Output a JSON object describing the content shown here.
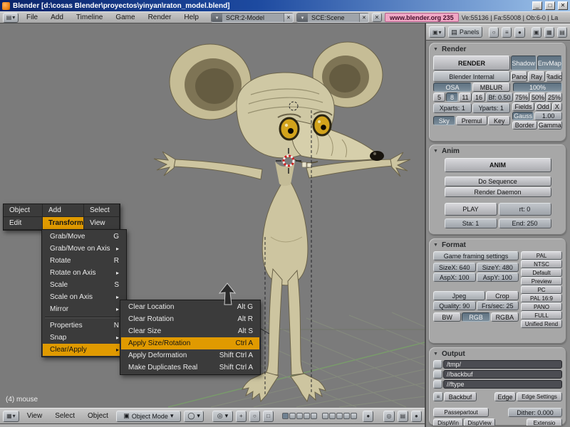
{
  "icons": {
    "minimize": "_",
    "maximize": "□",
    "close": "✕",
    "dropdown": "▾",
    "browse": "▤",
    "grid": "▦",
    "box": "▣",
    "submenu": "▸",
    "collapse": "▼",
    "lines": "≡",
    "ring": "○",
    "circle": "●",
    "target": "◎",
    "sphere": "◯",
    "plus": "+",
    "square": "□"
  },
  "titlebar": {
    "title": "Blender [d:\\cosas Blender\\proyectos\\yinyan\\raton_model.blend]"
  },
  "topbar": {
    "menus": [
      "File",
      "Add",
      "Timeline",
      "Game",
      "Render",
      "Help"
    ],
    "screen": "SCR:2-Model",
    "scene": "SCE:Scene",
    "site": "www.blender.org 235",
    "stats": "Ve:55136 | Fa:55008 | Ob:6-0 | La"
  },
  "toolbox": {
    "cells": [
      "Object",
      "Add",
      "Select",
      "Edit",
      "Transform",
      "View"
    ]
  },
  "transform_menu": {
    "items": [
      {
        "label": "Grab/Move",
        "shortcut": "G"
      },
      {
        "label": "Grab/Move on Axis",
        "submenu": true
      },
      {
        "label": "Rotate",
        "shortcut": "R"
      },
      {
        "label": "Rotate on Axis",
        "submenu": true
      },
      {
        "label": "Scale",
        "shortcut": "S"
      },
      {
        "label": "Scale on Axis",
        "submenu": true
      },
      {
        "label": "Mirror",
        "submenu": true
      },
      {
        "label": "Properties",
        "shortcut": "N"
      },
      {
        "label": "Snap",
        "submenu": true
      },
      {
        "label": "Clear/Apply",
        "submenu": true,
        "highlighted": true
      }
    ]
  },
  "clear_apply_menu": {
    "items": [
      {
        "label": "Clear Location",
        "shortcut": "Alt G"
      },
      {
        "label": "Clear Rotation",
        "shortcut": "Alt R"
      },
      {
        "label": "Clear Size",
        "shortcut": "Alt S"
      },
      {
        "label": "Apply Size/Rotation",
        "shortcut": "Ctrl A",
        "highlighted": true
      },
      {
        "label": "Apply Deformation",
        "shortcut": "Shift Ctrl A"
      },
      {
        "label": "Make Duplicates Real",
        "shortcut": "Shift Ctrl A"
      }
    ]
  },
  "viewport": {
    "object_info": "(4) mouse"
  },
  "view3d_header": {
    "menus": [
      "View",
      "Select",
      "Object"
    ],
    "mode": "Object Mode"
  },
  "buttons_header": {
    "panels": "Panels"
  },
  "render_panel": {
    "title": "Render",
    "render": "RENDER",
    "shadow": "Shadow",
    "envmap": "EnvMap",
    "engine": "Blender Internal",
    "pano": "Pano",
    "ray": "Ray",
    "radio": "Radio",
    "osa": "OSA",
    "mblur": "MBLUR",
    "pct100": "100%",
    "s5": "5",
    "s8": "8",
    "s11": "11",
    "s16": "16",
    "bf": "Bf: 0.50",
    "pct75": "75%",
    "pct50": "50%",
    "pct25": "25%",
    "xparts": "Xparts: 1",
    "yparts": "Yparts: 1",
    "fields": "Fields",
    "odd": "Odd",
    "x": "X",
    "sky": "Sky",
    "premul": "Premul",
    "key": "Key",
    "gauss": "Gauss",
    "gauss_val": "1.00",
    "border": "Border",
    "gamma": "Gamma"
  },
  "anim_panel": {
    "title": "Anim",
    "anim": "ANIM",
    "do_sequence": "Do Sequence",
    "render_daemon": "Render Daemon",
    "play": "PLAY",
    "rt": "rt: 0",
    "sta": "Sta: 1",
    "end": "End: 250"
  },
  "format_panel": {
    "title": "Format",
    "framing": "Game framing settings",
    "sizex": "SizeX: 640",
    "sizey": "SizeY: 480",
    "aspx": "AspX: 100",
    "aspy": "AspY: 100",
    "presets": [
      "PAL",
      "NTSC",
      "Default",
      "Preview",
      "PC",
      "PAL 16:9",
      "PANO",
      "FULL",
      "Unified Rend"
    ],
    "filetype": "Jpeg",
    "crop": "Crop",
    "quality": "Quality: 90",
    "frs": "Frs/sec: 25",
    "bw": "BW",
    "rgb": "RGB",
    "rgba": "RGBA"
  },
  "output_panel": {
    "title": "Output",
    "path1": "/tmp/",
    "path2": "//backbuf",
    "path3": "//ftype",
    "backbuf": "Backbuf",
    "edge": "Edge",
    "edge_settings": "Edge Settings",
    "passepartout": "Passepartout",
    "dither": "Dither: 0.000",
    "dispwin": "DispWin",
    "dispview": "DispView",
    "extension": "Extensio"
  }
}
